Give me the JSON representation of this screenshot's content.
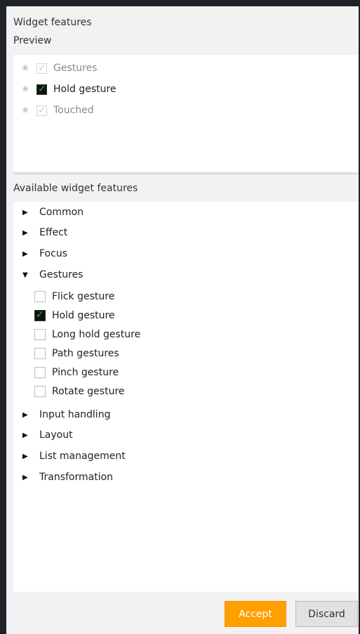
{
  "panel": {
    "title": "Widget features",
    "preview_label": "Preview",
    "available_label": "Available widget features"
  },
  "preview": {
    "items": [
      {
        "label": "Gestures",
        "checked": true,
        "dim": true
      },
      {
        "label": "Hold gesture",
        "checked": true,
        "dim": false
      },
      {
        "label": "Touched",
        "checked": true,
        "dim": true
      }
    ]
  },
  "tree": {
    "categories": [
      {
        "label": "Common",
        "expanded": false
      },
      {
        "label": "Effect",
        "expanded": false
      },
      {
        "label": "Focus",
        "expanded": false
      },
      {
        "label": "Gestures",
        "expanded": true
      },
      {
        "label": "Input handling",
        "expanded": false
      },
      {
        "label": "Layout",
        "expanded": false
      },
      {
        "label": "List management",
        "expanded": false
      },
      {
        "label": "Transformation",
        "expanded": false
      }
    ],
    "gesture_items": [
      {
        "label": "Flick gesture",
        "checked": false
      },
      {
        "label": "Hold gesture",
        "checked": true
      },
      {
        "label": "Long hold gesture",
        "checked": false
      },
      {
        "label": "Path gestures",
        "checked": false
      },
      {
        "label": "Pinch gesture",
        "checked": false
      },
      {
        "label": "Rotate gesture",
        "checked": false
      }
    ]
  },
  "buttons": {
    "accept": "Accept",
    "discard": "Discard"
  },
  "colors": {
    "accent": "#ff9f00",
    "check": "#1fbf2a"
  },
  "icons": {
    "star": "star-icon",
    "expand": "triangle-right-icon",
    "collapse": "triangle-down-icon"
  }
}
